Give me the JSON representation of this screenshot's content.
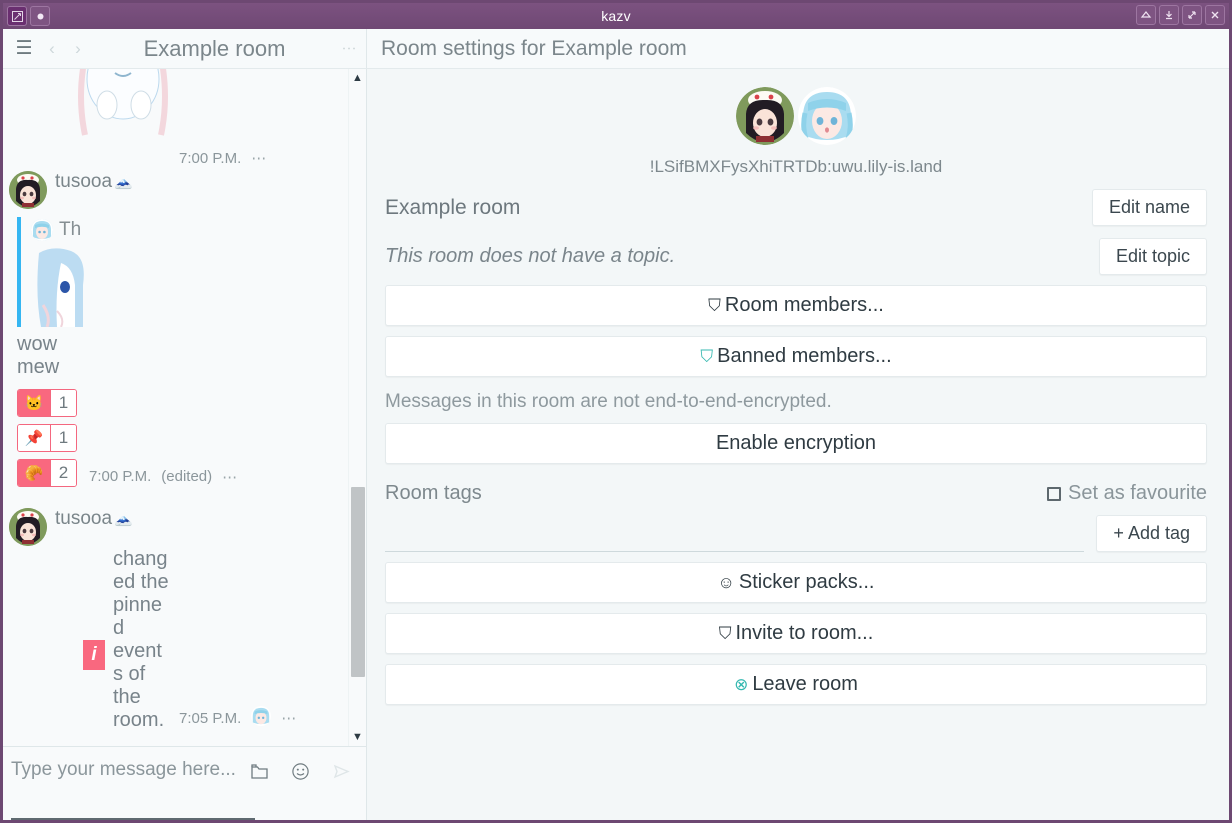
{
  "window": {
    "title": "kazv",
    "titlebar_buttons": [
      {
        "name": "window-menu-button",
        "glyph": "◩"
      },
      {
        "name": "window-sticky-button",
        "glyph": "●"
      }
    ],
    "titlebar_right_buttons": [
      {
        "name": "shade-button",
        "glyph": "△"
      },
      {
        "name": "minimize-button",
        "glyph": "⤓"
      },
      {
        "name": "maximize-button",
        "glyph": "⤡"
      },
      {
        "name": "close-button",
        "glyph": "×"
      }
    ]
  },
  "toolbar": {
    "menu_icon": "☰",
    "back_icon": "‹",
    "forward_icon": "›",
    "room_title": "Example room",
    "overflow_icon": "⋮",
    "settings_title": "Room settings for Example room"
  },
  "chat": {
    "messages": [
      {
        "time": "7:00 P.M.",
        "overflow": "⋯"
      },
      {
        "sender": "tusooa",
        "sender_emoji": "🗻",
        "quote_text": "Th",
        "body_lines": [
          "wow",
          "mew"
        ],
        "reactions": [
          {
            "emoji": "🐱",
            "count": "1",
            "mine": true
          },
          {
            "emoji": "📌",
            "count": "1",
            "mine": false
          },
          {
            "emoji": "🥐",
            "count": "2",
            "mine": true
          }
        ],
        "time": "7:00 P.M.",
        "edited": "(edited)",
        "overflow": "⋯"
      },
      {
        "sender": "tusooa",
        "sender_emoji": "🗻",
        "state_badge": "i",
        "state_text": "changed the pinned events of the room.",
        "time": "7:05 P.M.",
        "overflow": "⋯"
      }
    ],
    "scroll_up_icon": "▲",
    "scroll_down_icon": "▼"
  },
  "composer": {
    "placeholder": "Type your message here...",
    "attach_icon": "❐",
    "emoji_icon": "☺",
    "send_icon": "➤"
  },
  "settings": {
    "room_id": "!LSifBMXFysXhiTRTDb:uwu.lily-is.land",
    "room_name": "Example room",
    "room_topic": "This room does not have a topic.",
    "edit_name_label": "Edit name",
    "edit_topic_label": "Edit topic",
    "room_members_label": "Room members...",
    "room_members_icon": "⛉",
    "banned_members_label": "Banned members...",
    "banned_members_icon": "⛉",
    "encryption_note": "Messages in this room are not end-to-end-encrypted.",
    "enable_encryption_label": "Enable encryption",
    "room_tags_label": "Room tags",
    "set_favourite_label": "Set as favourite",
    "add_tag_label": "+ Add tag",
    "sticker_packs_label": "Sticker packs...",
    "sticker_packs_icon": "☺",
    "invite_label": "Invite to room...",
    "invite_icon": "⛉",
    "leave_label": "Leave room",
    "leave_icon": "⊗"
  },
  "colors": {
    "titlebar": "#6f4874",
    "accent_teal": "#35b8b0",
    "reaction_pink": "#f9687f",
    "quote_blue": "#35b6f2",
    "panel_bg": "#f3f7f8"
  }
}
